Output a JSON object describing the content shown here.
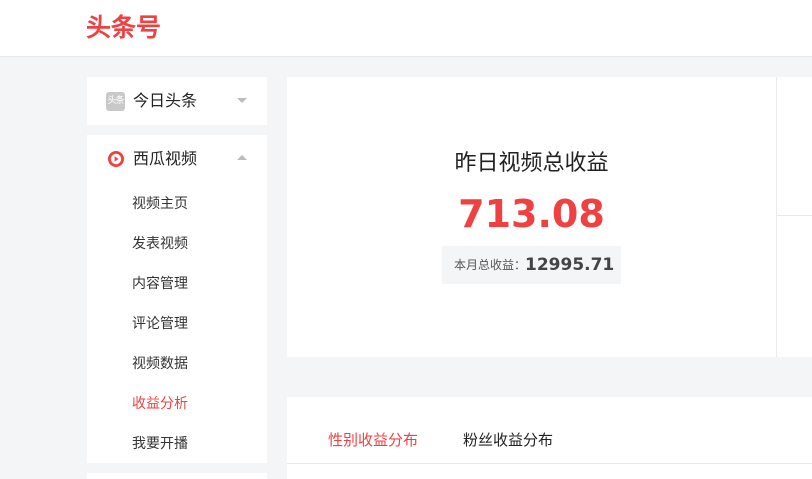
{
  "header": {
    "logo": "头条号",
    "brand_color": "#f04142"
  },
  "sidebar": {
    "toutiao": {
      "icon_text": "头条",
      "label": "今日头条",
      "icon": "toutiao-icon",
      "expanded": false
    },
    "xigua": {
      "label": "西瓜视频",
      "icon": "xigua-video-icon",
      "expanded": true,
      "items": [
        {
          "label": "视频主页",
          "active": false
        },
        {
          "label": "发表视频",
          "active": false
        },
        {
          "label": "内容管理",
          "active": false
        },
        {
          "label": "评论管理",
          "active": false
        },
        {
          "label": "视频数据",
          "active": false
        },
        {
          "label": "收益分析",
          "active": true
        },
        {
          "label": "我要开播",
          "active": false
        }
      ]
    }
  },
  "revenue": {
    "title": "昨日视频总收益",
    "value": "713.08",
    "month_label": "本月总收益：",
    "month_value": "12995.71"
  },
  "tabs": [
    {
      "label": "性别收益分布",
      "active": true
    },
    {
      "label": "粉丝收益分布",
      "active": false
    }
  ]
}
